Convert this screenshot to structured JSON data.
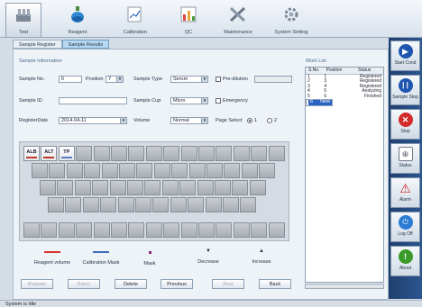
{
  "toolbar": {
    "tabs": [
      {
        "label": "Test",
        "icon": "test-tube-rack-icon"
      },
      {
        "label": "Reagent",
        "icon": "reagent-bottle-icon"
      },
      {
        "label": "Calibration",
        "icon": "calibration-icon"
      },
      {
        "label": "QC",
        "icon": "qc-chart-icon"
      },
      {
        "label": "Maintenance",
        "icon": "tools-icon"
      },
      {
        "label": "System Setting",
        "icon": "settings-icon"
      }
    ]
  },
  "subtabs": [
    "Sample Register",
    "Sample Results"
  ],
  "form": {
    "section_title": "Sample Information",
    "sample_no_label": "Sample No.",
    "sample_no": "6",
    "position_label": "Position",
    "position": "7",
    "sample_type_label": "Sample Type",
    "sample_type": "Serum",
    "predilution_label": "Pre-dilution",
    "sample_id_label": "Sample ID",
    "sample_id": "",
    "sample_cup_label": "Sample Cup",
    "sample_cup": "Micro",
    "emergency_label": "Emergency",
    "register_date_label": "RegisterDate",
    "register_date": "2014-04-11",
    "volume_label": "Volume",
    "volume": "Normal",
    "page_select_label": "Page Select",
    "page1": "1",
    "page2": "2"
  },
  "tray": {
    "labels": [
      "ALB",
      "ALT",
      "TP"
    ],
    "bar_colors": [
      "#c0392b",
      "#c0392b",
      "#5a7fc0"
    ]
  },
  "legend": [
    {
      "label": "Reagent volume",
      "color": "#d9302a",
      "mark": "line"
    },
    {
      "label": "Calibration Mask",
      "color": "#3d6fb8",
      "mark": "line"
    },
    {
      "label": "Mask",
      "color": "#8b2a6e",
      "mark": "dot"
    },
    {
      "label": "Decrease",
      "color": "#333",
      "mark": "down"
    },
    {
      "label": "Increase",
      "color": "#333",
      "mark": "up"
    }
  ],
  "buttons": [
    {
      "label": "Register",
      "enabled": false
    },
    {
      "label": "Batch",
      "enabled": false
    },
    {
      "label": "Delete",
      "enabled": true
    },
    {
      "label": "Previous",
      "enabled": true
    },
    {
      "label": "Next",
      "enabled": false
    },
    {
      "label": "Back",
      "enabled": true
    }
  ],
  "worklist": {
    "title": "Work List",
    "headers": [
      "S.No.",
      "Position",
      "Status"
    ],
    "rows": [
      [
        "1",
        "1",
        "Registered"
      ],
      [
        "2",
        "3",
        "Registered"
      ],
      [
        "3",
        "4",
        "Registered"
      ],
      [
        "4",
        "5",
        "Analyzing"
      ],
      [
        "5",
        "6",
        "Finished"
      ],
      [
        "6",
        "",
        "New"
      ]
    ]
  },
  "sidebar": [
    {
      "label": "Start Cond",
      "icon": "play-icon",
      "color": "#1d55b0"
    },
    {
      "label": "Sample Stop",
      "icon": "pause-icon",
      "color": "#1d55b0"
    },
    {
      "label": "Stop",
      "icon": "stop-icon",
      "color": "#d32a2a"
    },
    {
      "label": "Status",
      "icon": "status-icon",
      "color": "#556"
    },
    {
      "label": "Alarm",
      "icon": "alarm-icon",
      "color": "#d32a2a"
    },
    {
      "label": "Log Off",
      "icon": "log-off-icon",
      "color": "#2a7bd3"
    },
    {
      "label": "About",
      "icon": "about-icon",
      "color": "#3a9a2a"
    }
  ],
  "status_text": "System is Idle"
}
